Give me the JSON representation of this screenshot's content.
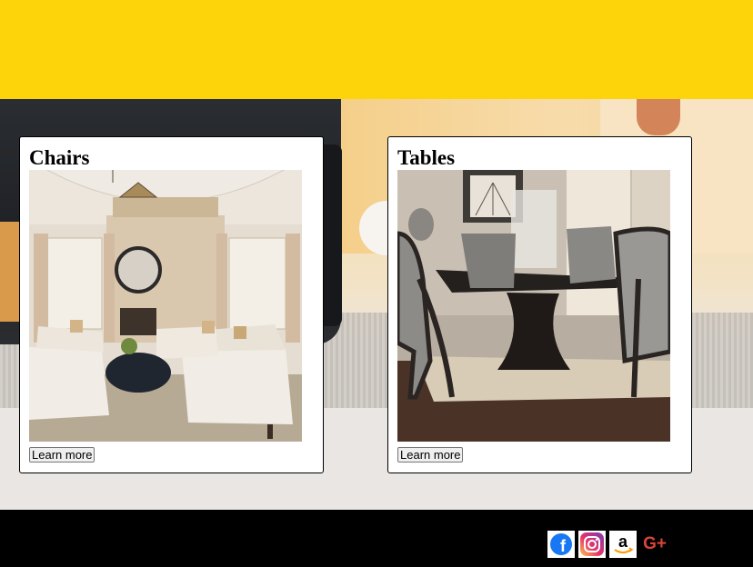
{
  "cards": [
    {
      "title": "Chairs",
      "button_label": "Learn more",
      "image": "living-room-armchairs-photo"
    },
    {
      "title": "Tables",
      "button_label": "Learn more",
      "image": "dining-table-set-photo"
    }
  ],
  "footer": {
    "social": [
      {
        "icon": "facebook-icon",
        "glyph": "f",
        "color": "#1877f2"
      },
      {
        "icon": "instagram-icon",
        "color": "#d6249f"
      },
      {
        "icon": "amazon-icon",
        "glyph": "a",
        "color": "#ff9900"
      },
      {
        "icon": "google-plus-icon",
        "glyph": "G+",
        "color": "#db4437"
      }
    ]
  },
  "colors": {
    "header": "#fdd40a",
    "footer": "#000000"
  }
}
